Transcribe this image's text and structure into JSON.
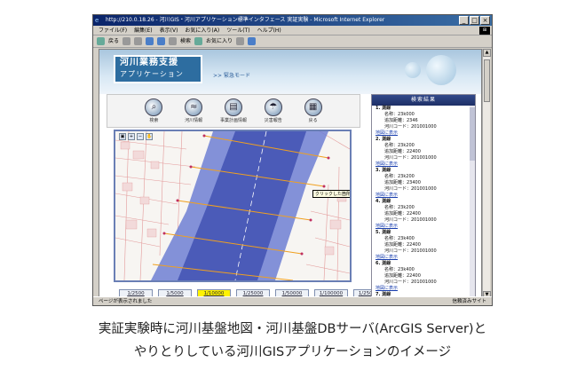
{
  "window": {
    "title": "http://210.0.18.26 - 河川GIS・河川アプリケーション標準インタフェース 実証実験 - Microsoft Internet Explorer",
    "buttons": [
      "_",
      "□",
      "×"
    ]
  },
  "menu": [
    "ファイル(F)",
    "編集(E)",
    "表示(V)",
    "お気に入り(A)",
    "ツール(T)",
    "ヘルプ(H)"
  ],
  "toolbar": {
    "back": "戻る",
    "search": "検索",
    "favorites": "お気に入り"
  },
  "app": {
    "logo_line1": "河川業務支援",
    "logo_line2": "アプリケーション",
    "emergency": ">> 緊急モード"
  },
  "functions": [
    {
      "label": "検索",
      "icon": "search-icon"
    },
    {
      "label": "河川情報",
      "icon": "river-info-icon"
    },
    {
      "label": "事業計画情報",
      "icon": "plan-icon"
    },
    {
      "label": "災害報告",
      "icon": "disaster-icon"
    },
    {
      "label": "戻る",
      "icon": "return-icon"
    }
  ],
  "map": {
    "tooltip": "クリックした箇所に存在する地物を表示します"
  },
  "scales": [
    {
      "label": "1/2500",
      "active": false
    },
    {
      "label": "1/5000",
      "active": false
    },
    {
      "label": "1/10000",
      "active": true
    },
    {
      "label": "1/25000",
      "active": false
    },
    {
      "label": "1/50000",
      "active": false
    },
    {
      "label": "1/100000",
      "active": false
    },
    {
      "label": "1/250000",
      "active": false
    }
  ],
  "results": {
    "title": "検索結果",
    "items": [
      {
        "no": "1. 測線",
        "name": "名称：23k000",
        "dist": "追加距離：2346",
        "code": "河川コード：201001000",
        "link": "地図に表示"
      },
      {
        "no": "2. 測線",
        "name": "名称：23k200",
        "dist": "追加距離：22400",
        "code": "河川コード：201001000",
        "link": "地図に表示"
      },
      {
        "no": "3. 測線",
        "name": "名称：23k200",
        "dist": "追加距離：23400",
        "code": "河川コード：201001000",
        "link": "地図に表示"
      },
      {
        "no": "4. 測線",
        "name": "名称：23k200",
        "dist": "追加距離：22400",
        "code": "河川コード：201001000",
        "link": "地図に表示"
      },
      {
        "no": "5. 測線",
        "name": "名称：23k400",
        "dist": "追加距離：22400",
        "code": "河川コード：201001000",
        "link": "地図に表示"
      },
      {
        "no": "6. 測線",
        "name": "名称：23k400",
        "dist": "追加距離：22400",
        "code": "河川コード：201001000",
        "link": "地図に表示"
      },
      {
        "no": "7. 測線",
        "name": "名称：23k600",
        "dist": "",
        "code": "",
        "link": ""
      }
    ]
  },
  "status": {
    "left": "ページが表示されました",
    "right": "信頼済みサイト"
  },
  "caption": {
    "line1": "実証実験時に河川基盤地図・河川基盤DBサーバ(ArcGIS Server)と",
    "line2": "やりとりしている河川GISアプリケーションのイメージ"
  }
}
